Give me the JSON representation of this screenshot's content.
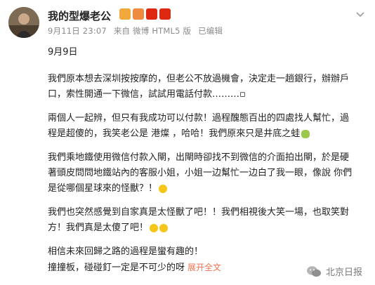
{
  "post": {
    "author": "我的型爆老公",
    "date": "9月11日 23:07",
    "source": "来自 微博 HTML5 版",
    "edited": "已编辑",
    "paragraphs": [
      "9月9日",
      "我們原本想去深圳按按摩的，但老公不放過機會，決定走一趟銀行，辦辦戶口，索性開通一下微信，試試用電話付款………▫",
      "兩個人一起辨，但只有我成功可以付款！過程醜態百出的四處找人幫忙，過程是超傻的，我笑老公是 港燦 ，哈哈！我們原來只是井底之蛙",
      "我們乘地鐵使用微信付款入閘，出閘時卻找不到微信的介面拍出閘，於是硬著頭皮問問地鐵站內的客服小姐，小姐一边幫忙一边白了我一眼，像說 你們是從哪個星球來的怪獸？！",
      "我們也突然感覺到自家真是太怪獸了吧！！我們相視後大笑一場，也取笑對方！我們真是太傻了吧！",
      "相信未來回歸之路的過程是蠻有趣的！",
      "撞撞板，碰碰釘一定是不可少的呀"
    ],
    "expand_label": "展开全文",
    "chevron_icon": "chevron-down-icon"
  },
  "watermark": {
    "label": "北京日报",
    "icon": "wechat-icon"
  },
  "colors": {
    "accent": "#eb7350",
    "meta": "#8a8a8a"
  }
}
